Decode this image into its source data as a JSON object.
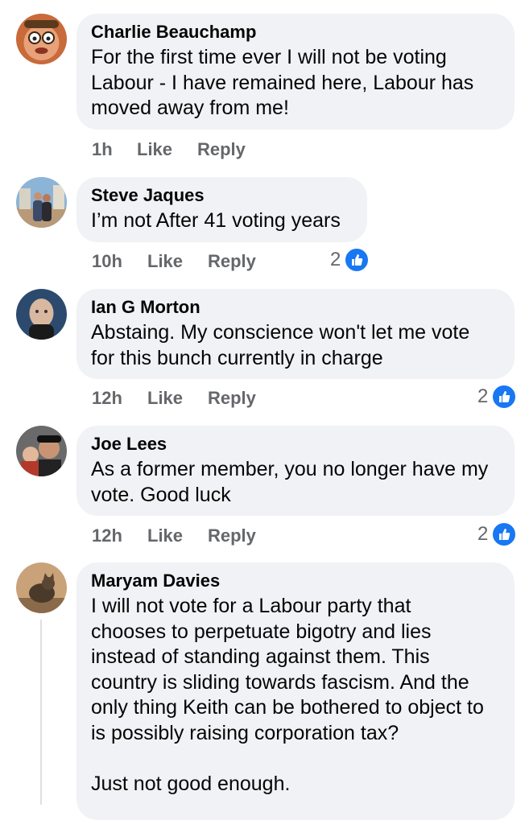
{
  "colors": {
    "bubble_bg": "#f0f2f5",
    "meta_text": "#65676b",
    "like_blue": "#1877f2"
  },
  "comments": [
    {
      "author": "Charlie Beauchamp",
      "text": "For the first time ever I will not be voting\nLabour - I have remained here, Labour has\nmoved away from me!",
      "time": "1h",
      "like_label": "Like",
      "reply_label": "Reply",
      "reaction_count": ""
    },
    {
      "author": "Steve Jaques",
      "text": "I’m not After 41 voting years",
      "time": "10h",
      "like_label": "Like",
      "reply_label": "Reply",
      "reaction_count": "2"
    },
    {
      "author": "Ian G Morton",
      "text": "Abstaing. My conscience won't let me vote\nfor this bunch currently in charge",
      "time": "12h",
      "like_label": "Like",
      "reply_label": "Reply",
      "reaction_count": "2"
    },
    {
      "author": "Joe Lees",
      "text": "As a former member, you no longer have my\nvote. Good luck",
      "time": "12h",
      "like_label": "Like",
      "reply_label": "Reply",
      "reaction_count": "2"
    },
    {
      "author": "Maryam Davies",
      "text": "I will not vote for a Labour party that\nchooses to perpetuate bigotry and lies\ninstead of standing against them. This\ncountry is sliding towards fascism. And the\nonly thing Keith can be bothered to object to\nis possibly raising corporation tax?\n\nJust not good enough.",
      "time": "",
      "like_label": "",
      "reply_label": "",
      "reaction_count": ""
    }
  ]
}
